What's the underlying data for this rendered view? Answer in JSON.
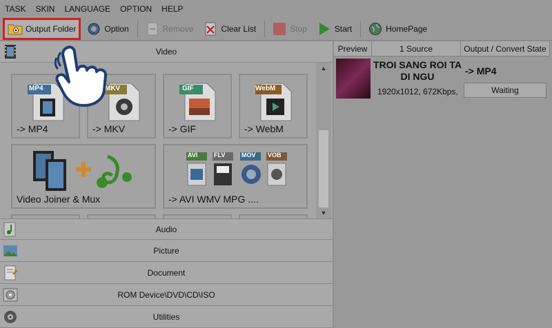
{
  "menu": [
    "TASK",
    "SKIN",
    "LANGUAGE",
    "OPTION",
    "HELP"
  ],
  "toolbar": {
    "output_folder": "Output Folder",
    "option": "Option",
    "remove": "Remove",
    "clear_list": "Clear List",
    "stop": "Stop",
    "start": "Start",
    "homepage": "HomePage"
  },
  "categories": {
    "video": "Video",
    "audio": "Audio",
    "picture": "Picture",
    "document": "Document",
    "rom": "ROM Device\\DVD\\CD\\ISO",
    "utilities": "Utilities"
  },
  "tiles": [
    {
      "label": "-> MP4",
      "badge": "MP4"
    },
    {
      "label": "-> MKV",
      "badge": "MKV"
    },
    {
      "label": "-> GIF",
      "badge": "GIF"
    },
    {
      "label": "-> WebM",
      "badge": "WebM"
    },
    {
      "label": "Video Joiner & Mux"
    },
    {
      "label": "-> AVI WMV MPG ....",
      "badges": [
        "AVI",
        "FLV",
        "MOV",
        "VOB"
      ]
    }
  ],
  "task_list": {
    "headers": {
      "preview": "Preview",
      "source": "1 Source",
      "output": "Output / Convert State"
    },
    "rows": [
      {
        "title": "TROI SANG ROI TA DI NGU",
        "info": "1920x1012, 672Kbps, €",
        "format": "-> MP4",
        "state": "Waiting"
      }
    ]
  }
}
